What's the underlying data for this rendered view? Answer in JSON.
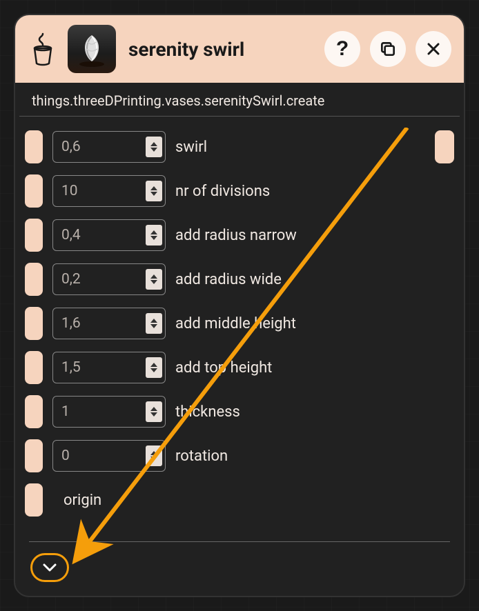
{
  "header": {
    "title": "serenity swirl"
  },
  "breadcrumb": "things.threeDPrinting.vases.serenitySwirl.create",
  "params": [
    {
      "value": "0,6",
      "label": "swirl"
    },
    {
      "value": "10",
      "label": "nr of divisions"
    },
    {
      "value": "0,4",
      "label": "add radius narrow"
    },
    {
      "value": "0,2",
      "label": "add radius wide"
    },
    {
      "value": "1,6",
      "label": "add middle height"
    },
    {
      "value": "1,5",
      "label": "add top height"
    },
    {
      "value": "1",
      "label": "thickness"
    },
    {
      "value": "0",
      "label": "rotation"
    }
  ],
  "origin": {
    "label": "origin"
  },
  "colors": {
    "header_bg": "#f6d4be",
    "panel_bg": "#212121",
    "text": "#f0e8e2",
    "annotation": "#f59e0b"
  }
}
